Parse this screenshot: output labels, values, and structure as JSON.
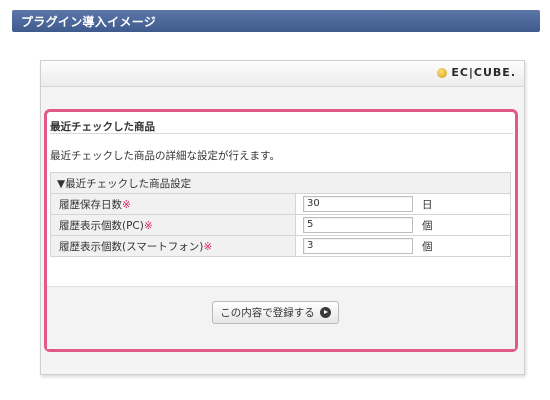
{
  "banner": {
    "title": "プラグイン導入イメージ"
  },
  "header": {
    "logo_text": "EC|CUBE."
  },
  "plugin": {
    "title": "最近チェックした商品",
    "description": "最近チェックした商品の詳細な設定が行えます。",
    "section_header": "▼最近チェックした商品設定",
    "required_mark": "※",
    "rows": [
      {
        "label": "履歴保存日数",
        "value": "30",
        "unit": "日"
      },
      {
        "label": "履歴表示個数(PC)",
        "value": "5",
        "unit": "個"
      },
      {
        "label": "履歴表示個数(スマートフォン)",
        "value": "3",
        "unit": "個"
      }
    ],
    "submit_label": "この内容で登録する"
  },
  "colors": {
    "banner": "#4a65997",
    "highlight_border": "#e05a85",
    "required": "#e0245e"
  }
}
